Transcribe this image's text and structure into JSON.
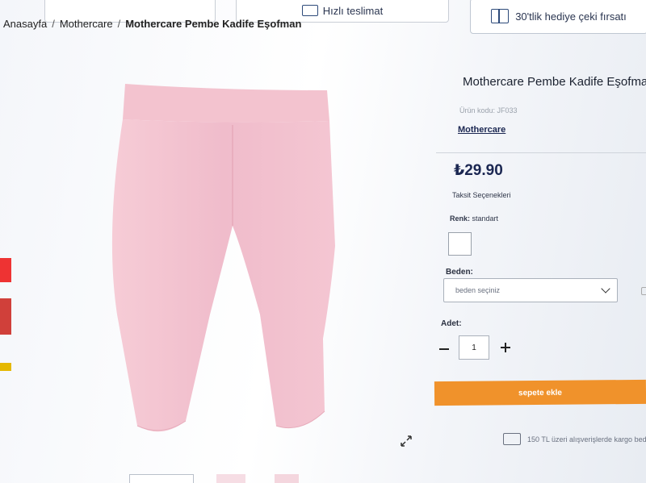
{
  "topbar": {
    "shipping_label": "Hızlı teslimat",
    "gift_label": "30'tlik hediye çeki fırsatı"
  },
  "breadcrumb": {
    "home": "Anasayfa",
    "category": "Mothercare",
    "current": "Mothercare Pembe Kadife Eşofman",
    "separator": "/"
  },
  "product": {
    "title": "Mothercare Pembe Kadife Eşofman",
    "code": "Ürün kodu: JF033",
    "brand": "Mothercare",
    "price": "₺29.90",
    "installment_label": "Taksit Seçenekleri",
    "color_label": "Renk:",
    "color_value": "standart",
    "size_label": "Beden:",
    "size_placeholder": "beden seçiniz",
    "qty_label": "Adet:",
    "qty_value": "1",
    "add_to_cart": "sepete ekle",
    "shipping_note": "150 TL üzeri alışverişlerde kargo bedava"
  },
  "colors": {
    "accent_orange": "#f0922b",
    "brand_navy": "#1b2752",
    "product_pink": "#f1bfcb"
  },
  "icons": {
    "gift": "gift-icon",
    "truck": "truck-icon",
    "chevron": "chevron-down-icon",
    "expand": "expand-icon"
  }
}
